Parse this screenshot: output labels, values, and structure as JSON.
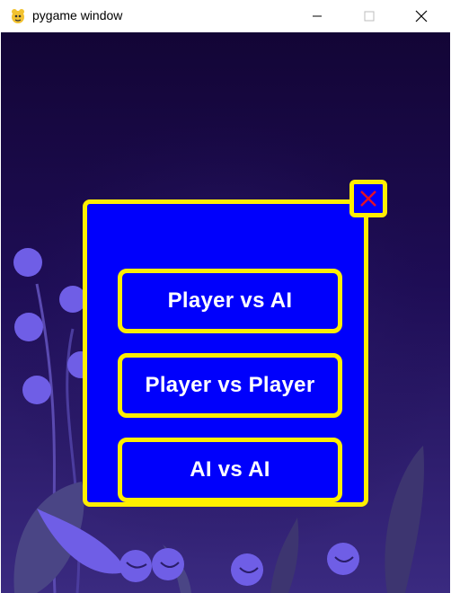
{
  "window": {
    "title": "pygame window",
    "icon": "pygame-snake-icon",
    "controls": [
      "minimize-icon",
      "maximize-icon",
      "close-icon"
    ]
  },
  "menu": {
    "buttons": [
      {
        "label": "Player vs AI"
      },
      {
        "label": "Player vs Player"
      },
      {
        "label": "AI vs AI"
      }
    ],
    "close_icon": "close-x-icon"
  },
  "colors": {
    "panel_fill": "#0000fc",
    "panel_border": "#ffee00",
    "close_x": "#e0102a",
    "background_top": "#130536",
    "background_bottom": "#3a2a80",
    "decor": "#6f5ee6"
  }
}
